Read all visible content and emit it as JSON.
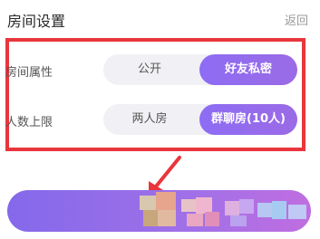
{
  "header": {
    "title": "房间设置",
    "back_label": "返回"
  },
  "settings": {
    "room_type": {
      "label": "房间属性",
      "options": [
        "公开",
        "好友私密"
      ],
      "selected": "好友私密"
    },
    "max_people": {
      "label": "人数上限",
      "options": [
        "两人房",
        "群聊房(10人)"
      ],
      "selected": "群聊房(10人)"
    }
  },
  "colors": {
    "accent": "#8d6cf4",
    "highlight_border": "#e9353c"
  },
  "annotation_arrow": {
    "color": "#e9353c"
  },
  "icons": [
    "arrow-annotation-icon"
  ]
}
